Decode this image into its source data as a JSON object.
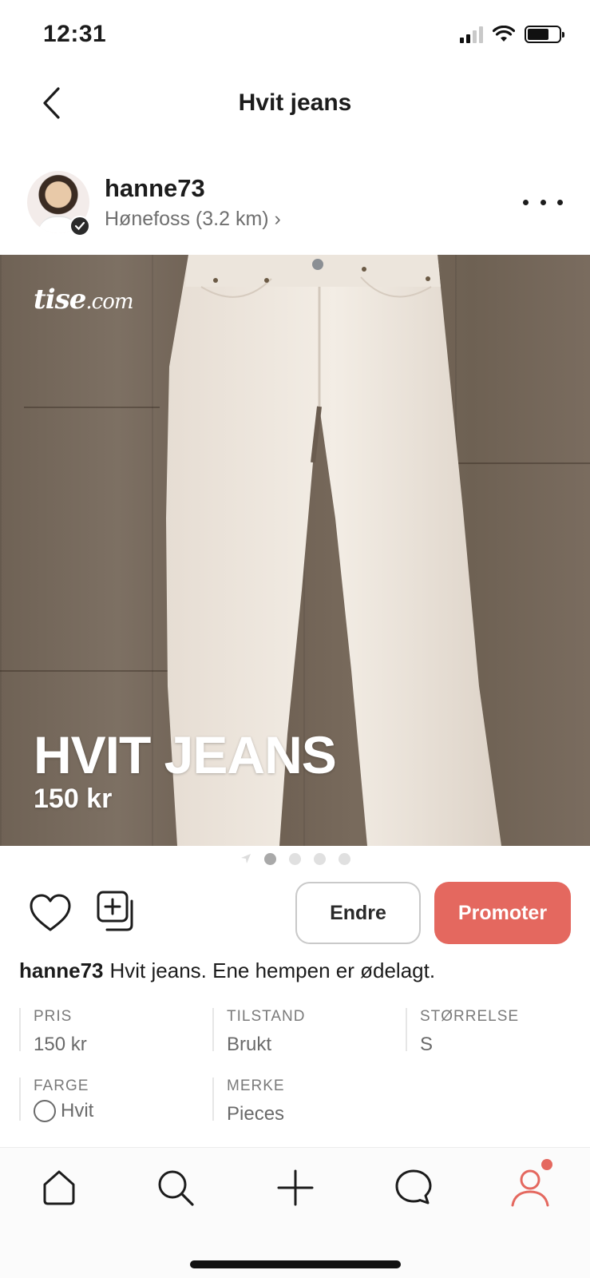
{
  "status_bar": {
    "time": "12:31"
  },
  "header": {
    "title": "Hvit jeans",
    "back_icon": "chevron-left-icon"
  },
  "seller": {
    "username": "hanne73",
    "location": "Hønefoss (3.2 km) ›",
    "verified_icon": "check-icon"
  },
  "image": {
    "watermark": "tise",
    "watermark_suffix": ".com",
    "overlay_title": "HVIT JEANS",
    "overlay_price": "150 kr",
    "page_count": 4,
    "active_page": 1
  },
  "actions": {
    "edit_label": "Endre",
    "promote_label": "Promoter",
    "accent_color": "#e4685f"
  },
  "description": {
    "username": "hanne73",
    "text": "Hvit jeans. Ene hempen er ødelagt."
  },
  "attributes": {
    "price": {
      "label": "PRIS",
      "value": "150 kr"
    },
    "condition": {
      "label": "TILSTAND",
      "value": "Brukt"
    },
    "size": {
      "label": "STØRRELSE",
      "value": "S"
    },
    "color": {
      "label": "FARGE",
      "value": "Hvit",
      "swatch": "#ffffff"
    },
    "brand": {
      "label": "MERKE",
      "value": "Pieces"
    }
  },
  "tab_bar": {
    "items": [
      "home-icon",
      "search-icon",
      "add-icon",
      "chat-icon",
      "profile-icon"
    ],
    "active": "profile-icon",
    "notification": true
  }
}
